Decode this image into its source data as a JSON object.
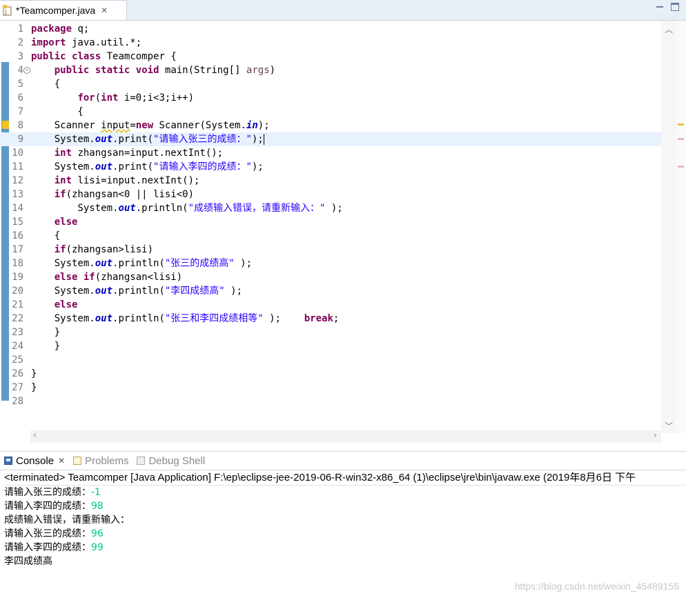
{
  "editor": {
    "tab_title": "*Teamcomper.java",
    "tab_close": "✕",
    "lines": [
      {
        "n": "1",
        "tokens": [
          {
            "t": "package",
            "c": "kw"
          },
          {
            "t": " q;"
          }
        ]
      },
      {
        "n": "2",
        "tokens": [
          {
            "t": "import",
            "c": "kw"
          },
          {
            "t": " java.util.*;"
          }
        ]
      },
      {
        "n": "3",
        "tokens": [
          {
            "t": "public",
            "c": "kw"
          },
          {
            "t": " "
          },
          {
            "t": "class",
            "c": "kw"
          },
          {
            "t": " Teamcomper {"
          }
        ]
      },
      {
        "n": "4",
        "fold": "−",
        "tokens": [
          {
            "t": "    "
          },
          {
            "t": "public",
            "c": "kw"
          },
          {
            "t": " "
          },
          {
            "t": "static",
            "c": "kw"
          },
          {
            "t": " "
          },
          {
            "t": "void",
            "c": "kw"
          },
          {
            "t": " main(String[] "
          },
          {
            "t": "args",
            "c": "param"
          },
          {
            "t": ")"
          }
        ]
      },
      {
        "n": "5",
        "tokens": [
          {
            "t": "    {"
          }
        ]
      },
      {
        "n": "6",
        "tokens": [
          {
            "t": "        "
          },
          {
            "t": "for",
            "c": "kw"
          },
          {
            "t": "("
          },
          {
            "t": "int",
            "c": "kw"
          },
          {
            "t": " i=0;i<3;i++)"
          }
        ]
      },
      {
        "n": "7",
        "tokens": [
          {
            "t": "        {"
          }
        ]
      },
      {
        "n": "8",
        "warn": true,
        "tokens": [
          {
            "t": "    Scanner "
          },
          {
            "t": "input",
            "c": "squig"
          },
          {
            "t": "="
          },
          {
            "t": "new",
            "c": "kw"
          },
          {
            "t": " Scanner(System."
          },
          {
            "t": "in",
            "c": "field"
          },
          {
            "t": ");"
          }
        ]
      },
      {
        "n": "9",
        "current": true,
        "caret": true,
        "tokens": [
          {
            "t": "    System."
          },
          {
            "t": "out",
            "c": "field"
          },
          {
            "t": ".print("
          },
          {
            "t": "\"请输入张三的成绩：\"",
            "c": "str"
          },
          {
            "t": ");"
          }
        ]
      },
      {
        "n": "10",
        "tokens": [
          {
            "t": "    "
          },
          {
            "t": "int",
            "c": "kw"
          },
          {
            "t": " zhangsan=input.nextInt();"
          }
        ]
      },
      {
        "n": "11",
        "tokens": [
          {
            "t": "    System."
          },
          {
            "t": "out",
            "c": "field"
          },
          {
            "t": ".print("
          },
          {
            "t": "\"请输入李四的成绩：\"",
            "c": "str"
          },
          {
            "t": ");"
          }
        ]
      },
      {
        "n": "12",
        "tokens": [
          {
            "t": "    "
          },
          {
            "t": "int",
            "c": "kw"
          },
          {
            "t": " lisi=input.nextInt();"
          }
        ]
      },
      {
        "n": "13",
        "tokens": [
          {
            "t": "    "
          },
          {
            "t": "if",
            "c": "kw"
          },
          {
            "t": "(zhangsan<0 || lisi<0)"
          }
        ]
      },
      {
        "n": "14",
        "tokens": [
          {
            "t": "        System."
          },
          {
            "t": "out",
            "c": "field"
          },
          {
            "t": ".println("
          },
          {
            "t": "\"成绩输入错误，请重新输入：\"",
            "c": "str"
          },
          {
            "t": " );"
          }
        ]
      },
      {
        "n": "15",
        "tokens": [
          {
            "t": "    "
          },
          {
            "t": "else",
            "c": "kw"
          }
        ]
      },
      {
        "n": "16",
        "tokens": [
          {
            "t": "    {"
          }
        ]
      },
      {
        "n": "17",
        "tokens": [
          {
            "t": "    "
          },
          {
            "t": "if",
            "c": "kw"
          },
          {
            "t": "(zhangsan>lisi)"
          }
        ]
      },
      {
        "n": "18",
        "tokens": [
          {
            "t": "    System."
          },
          {
            "t": "out",
            "c": "field"
          },
          {
            "t": ".println("
          },
          {
            "t": "\"张三的成绩高\"",
            "c": "str"
          },
          {
            "t": " );"
          }
        ]
      },
      {
        "n": "19",
        "tokens": [
          {
            "t": "    "
          },
          {
            "t": "else",
            "c": "kw"
          },
          {
            "t": " "
          },
          {
            "t": "if",
            "c": "kw"
          },
          {
            "t": "(zhangsan<lisi)"
          }
        ]
      },
      {
        "n": "20",
        "tokens": [
          {
            "t": "    System."
          },
          {
            "t": "out",
            "c": "field"
          },
          {
            "t": ".println("
          },
          {
            "t": "\"李四成绩高\"",
            "c": "str"
          },
          {
            "t": " );"
          }
        ]
      },
      {
        "n": "21",
        "tokens": [
          {
            "t": "    "
          },
          {
            "t": "else",
            "c": "kw"
          }
        ]
      },
      {
        "n": "22",
        "tokens": [
          {
            "t": "    System."
          },
          {
            "t": "out",
            "c": "field"
          },
          {
            "t": ".println("
          },
          {
            "t": "\"张三和李四成绩相等\"",
            "c": "str"
          },
          {
            "t": " );    "
          },
          {
            "t": "break",
            "c": "kw"
          },
          {
            "t": ";"
          }
        ]
      },
      {
        "n": "23",
        "tokens": [
          {
            "t": "    }"
          }
        ]
      },
      {
        "n": "24",
        "tokens": [
          {
            "t": "    }"
          }
        ]
      },
      {
        "n": "25",
        "tokens": []
      },
      {
        "n": "26",
        "tokens": [
          {
            "t": "}"
          }
        ]
      },
      {
        "n": "27",
        "tokens": [
          {
            "t": "}"
          }
        ]
      },
      {
        "n": "28",
        "tokens": []
      }
    ],
    "colors": {
      "keyword": "#7f0055",
      "string": "#2a00ff",
      "field": "#0000c0",
      "gutter": "#5d9bc5",
      "current_line": "#e8f2fe"
    }
  },
  "views": {
    "tabs": [
      {
        "label": "Console",
        "icon": "console-icon",
        "active": true,
        "close": "✕"
      },
      {
        "label": "Problems",
        "icon": "problems-icon",
        "active": false
      },
      {
        "label": "Debug Shell",
        "icon": "debug-shell-icon",
        "active": false
      }
    ]
  },
  "console": {
    "status": "<terminated> Teamcomper [Java Application] F:\\ep\\eclipse-jee-2019-06-R-win32-x86_64 (1)\\eclipse\\jre\\bin\\javaw.exe (2019年8月6日 下午",
    "output": [
      {
        "text": "请输入张三的成绩：",
        "input": "-1"
      },
      {
        "text": "请输入李四的成绩：",
        "input": "98"
      },
      {
        "text": "成绩输入错误，请重新输入：",
        "input": ""
      },
      {
        "text": "请输入张三的成绩：",
        "input": "96"
      },
      {
        "text": "请输入李四的成绩：",
        "input": "99"
      },
      {
        "text": "李四成绩高",
        "input": ""
      }
    ],
    "input_color": "#00c87d"
  },
  "watermark": "https://blog.csdn.net/weixin_45489155"
}
